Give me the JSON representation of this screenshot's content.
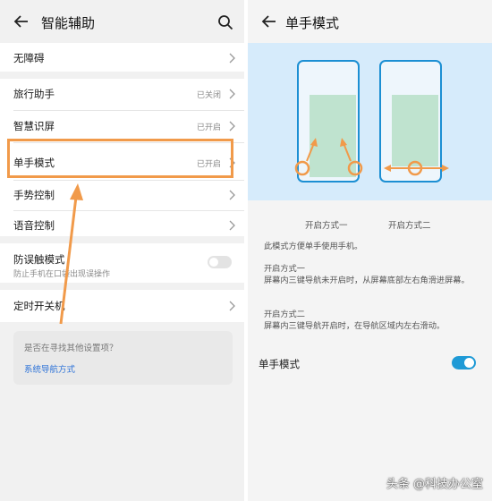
{
  "left": {
    "title": "智能辅助",
    "items": [
      {
        "label": "无障碍",
        "status": ""
      },
      {
        "label": "旅行助手",
        "status": "已关闭"
      },
      {
        "label": "智慧识屏",
        "status": "已开启"
      },
      {
        "label": "单手模式",
        "status": "已开启"
      },
      {
        "label": "手势控制",
        "status": ""
      },
      {
        "label": "语音控制",
        "status": ""
      }
    ],
    "misoperation": {
      "label": "防误触模式",
      "sub": "防止手机在口袋出现误操作",
      "enabled": false
    },
    "timer": {
      "label": "定时开关机"
    },
    "tip": {
      "question": "是否在寻找其他设置项？",
      "link": "系统导航方式"
    }
  },
  "right": {
    "title": "单手模式",
    "caption1": "开启方式一",
    "caption2": "开启方式二",
    "desc": "此模式方便单手使用手机。",
    "method1_title": "开启方式一",
    "method1_text": "屏幕内三键导航未开启时，从屏幕底部左右角滑进屏幕。",
    "method2_title": "开启方式二",
    "method2_text": "屏幕内三键导航开启时，在导航区域内左右滑动。",
    "toggle_label": "单手模式",
    "toggle_on": true
  },
  "watermark": "头条 @科技办公室",
  "colors": {
    "highlight": "#f19a4a",
    "accent": "#1f9ad6",
    "illustration_bg": "#d6ebfb",
    "screen_fill": "#bfe3cf"
  }
}
